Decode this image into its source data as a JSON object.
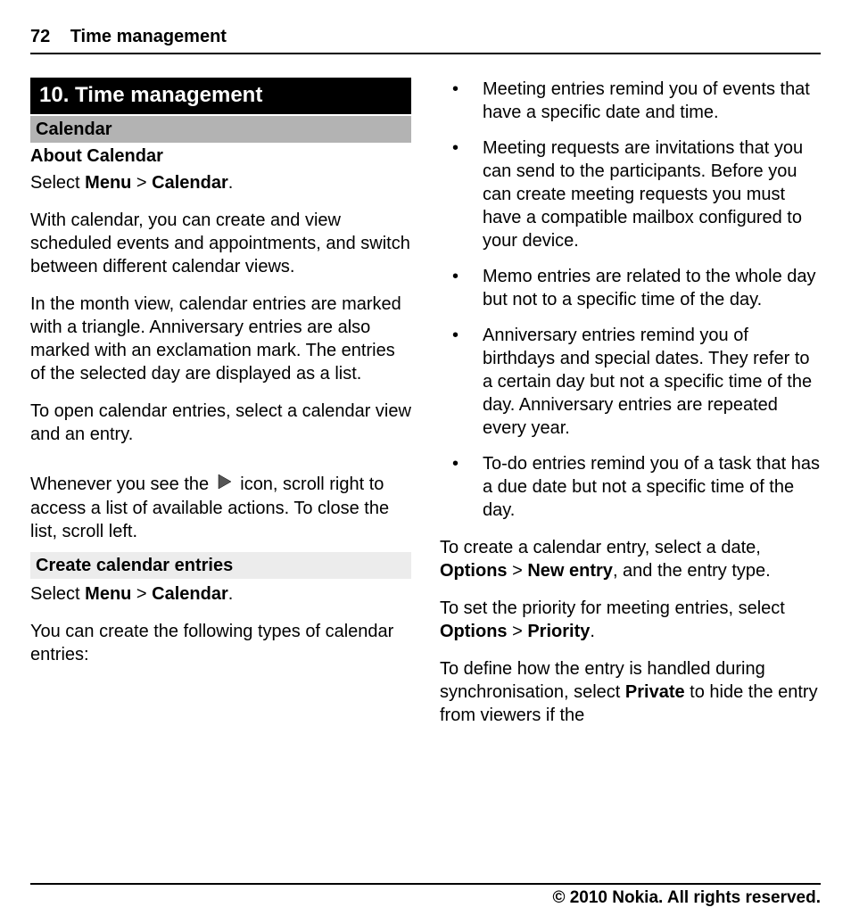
{
  "header": {
    "page_number": "72",
    "title": "Time management"
  },
  "left": {
    "chapter": "10.    Time management",
    "section_calendar": "Calendar",
    "subhead_about": "About Calendar",
    "select_prefix": "Select ",
    "menu": "Menu",
    "gt": " > ",
    "calendar_bold": "Calendar",
    "period": ".",
    "p1": "With calendar, you can create and view scheduled events and appointments, and switch between different calendar views.",
    "p2": "In the month view, calendar entries are marked with a triangle. Anniversary entries are also marked with an exclamation mark. The entries of the selected day are displayed as a list.",
    "p3": "To open calendar entries, select a calendar view and an entry.",
    "p4a": "Whenever you see the ",
    "p4b": " icon, scroll right to access a list of available actions. To close the list, scroll left.",
    "light_section": "Create calendar entries",
    "p5": "You can create the following types of calendar entries:"
  },
  "right": {
    "bullets": [
      "Meeting entries remind you of events that have a specific date and time.",
      "Meeting requests are invitations that you can send to the participants. Before you can create meeting requests you must have a compatible mailbox configured to your device.",
      "Memo entries are related to the whole day but not to a specific time of the day.",
      "Anniversary entries remind you of birthdays and special dates. They refer to a certain day but not a specific time of the day. Anniversary entries are repeated every year.",
      "To-do entries remind you of a task that has a due date but not a specific time of the day."
    ],
    "p1a": "To create a calendar entry, select a date, ",
    "options": "Options",
    "gt": " > ",
    "new_entry": "New entry",
    "p1b": ", and the entry type.",
    "p2a": "To set the priority for meeting entries, select ",
    "priority": "Priority",
    "period": ".",
    "p3a": "To define how the entry is handled during synchronisation, select ",
    "private_bold": "Private",
    "p3b": " to hide the entry from viewers if the"
  },
  "footer": "© 2010 Nokia. All rights reserved."
}
